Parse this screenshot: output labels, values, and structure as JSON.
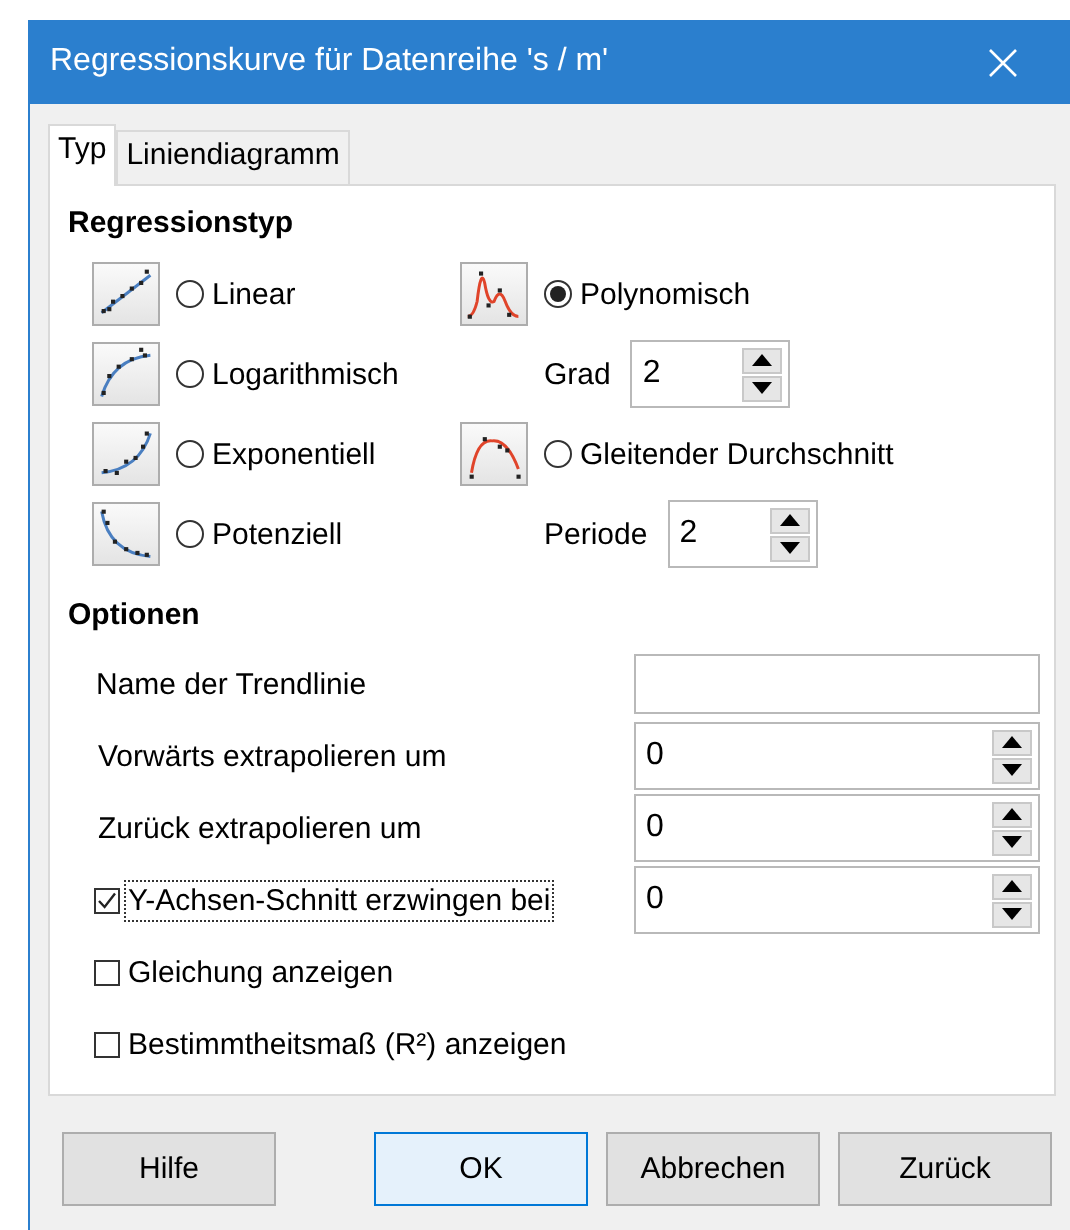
{
  "window": {
    "title": "Regressionskurve für Datenreihe 's / m'"
  },
  "tabs": [
    {
      "label": "Typ",
      "selected": true
    },
    {
      "label": "Liniendiagramm",
      "selected": false
    }
  ],
  "regression": {
    "heading": "Regressionstyp",
    "columns": [
      {
        "types": [
          {
            "kind": "linear",
            "label": "Linear",
            "selected": false
          },
          {
            "kind": "logarithmic",
            "label": "Logarithmisch",
            "selected": false
          },
          {
            "kind": "exponential",
            "label": "Exponentiell",
            "selected": false
          },
          {
            "kind": "power",
            "label": "Potenziell",
            "selected": false
          }
        ]
      },
      {
        "types": [
          {
            "kind": "polynomial",
            "label": "Polynomisch",
            "selected": true,
            "parameter": {
              "label": "Grad",
              "value": "2"
            }
          },
          {
            "kind": "moving_average",
            "label": "Gleitender Durchschnitt",
            "selected": false,
            "parameter": {
              "label": "Periode",
              "value": "2"
            }
          }
        ]
      }
    ]
  },
  "options": {
    "heading": "Optionen",
    "rows": [
      {
        "kind": "text",
        "label": "Name der Trendlinie"
      },
      {
        "kind": "spin",
        "label": "Vorwärts extrapolieren um",
        "value": "0"
      },
      {
        "kind": "spin",
        "label": "Zurück extrapolieren um",
        "value": "0"
      },
      {
        "kind": "checkspin",
        "label": "Y-Achsen-Schnitt erzwingen bei",
        "value": "0",
        "checked": true,
        "focused": true
      },
      {
        "kind": "check",
        "label": "Gleichung anzeigen",
        "checked": false,
        "focused": false
      },
      {
        "kind": "check",
        "label": "Bestimmtheitsmaß (R²) anzeigen",
        "checked": false,
        "focused": false
      }
    ]
  },
  "buttons": [
    {
      "label": "Hilfe",
      "default": false
    },
    {
      "label": "OK",
      "default": true
    },
    {
      "label": "Abbrechen",
      "default": false
    },
    {
      "label": "Zurück",
      "default": false
    }
  ]
}
